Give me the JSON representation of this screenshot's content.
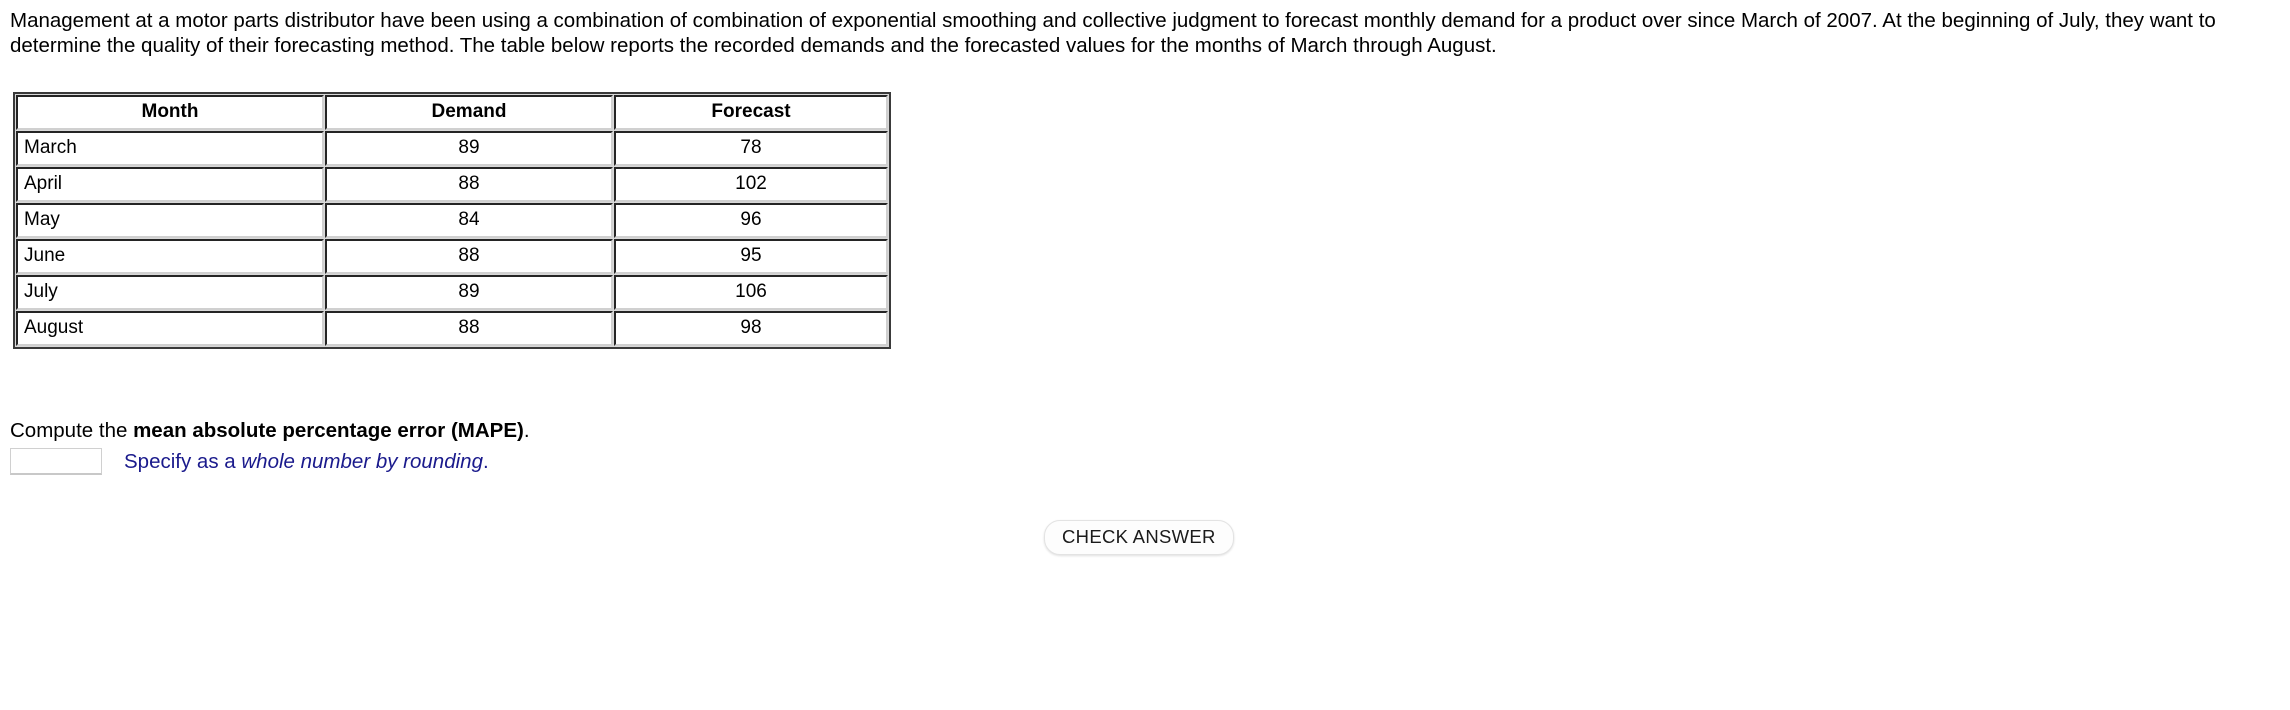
{
  "problem": {
    "statement": "Management at a motor parts distributor have been using a combination of combination of exponential smoothing and collective judgment to forecast monthly demand for a product over since March of 2007. At the beginning of July, they want to determine the quality of their forecasting method. The table below reports the recorded demands and the forecasted values for the months of March through August."
  },
  "table": {
    "headers": [
      "Month",
      "Demand",
      "Forecast"
    ],
    "rows": [
      {
        "month": "March",
        "demand": "89",
        "forecast": "78"
      },
      {
        "month": "April",
        "demand": "88",
        "forecast": "102"
      },
      {
        "month": "May",
        "demand": "84",
        "forecast": "96"
      },
      {
        "month": "June",
        "demand": "88",
        "forecast": "95"
      },
      {
        "month": "July",
        "demand": "89",
        "forecast": "106"
      },
      {
        "month": "August",
        "demand": "88",
        "forecast": "98"
      }
    ]
  },
  "question": {
    "prefix": "Compute the ",
    "bold_term": "mean absolute percentage error (MAPE)",
    "suffix": "."
  },
  "answer": {
    "value": "",
    "placeholder": "",
    "hint_prefix": "Specify as a ",
    "hint_italic": "whole number by rounding",
    "hint_suffix": ".",
    "hint_color": "#1a1a8c"
  },
  "actions": {
    "check_answer_label": "CHECK ANSWER"
  }
}
